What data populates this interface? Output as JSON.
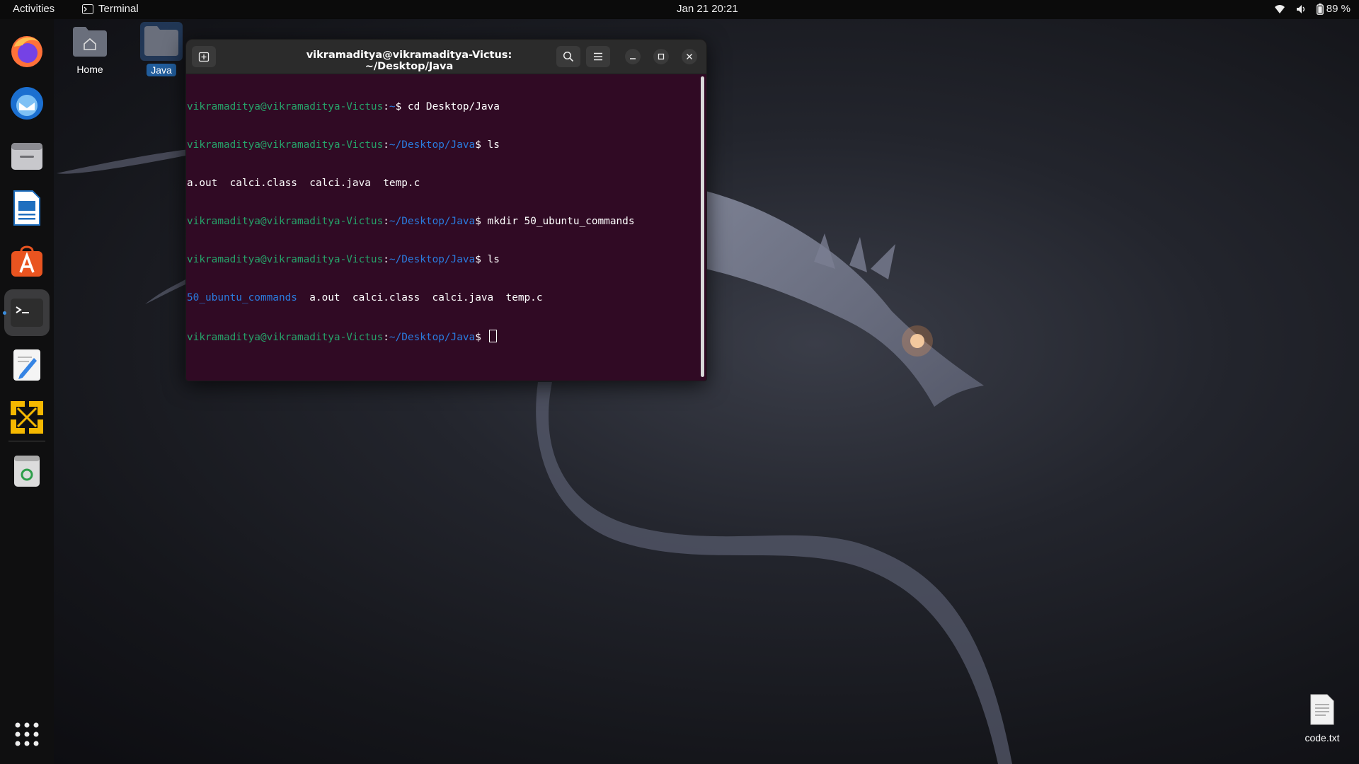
{
  "topbar": {
    "activities": "Activities",
    "app_name": "Terminal",
    "clock": "Jan 21  20:21",
    "battery": "89 %"
  },
  "dock": {
    "items": [
      {
        "name": "firefox",
        "icon": "firefox-icon"
      },
      {
        "name": "thunderbird",
        "icon": "thunderbird-icon"
      },
      {
        "name": "files",
        "icon": "files-icon"
      },
      {
        "name": "libreoffice-writer",
        "icon": "writer-icon"
      },
      {
        "name": "app-center",
        "icon": "app-center-icon"
      },
      {
        "name": "terminal",
        "icon": "terminal-icon",
        "active": true
      },
      {
        "name": "text-editor",
        "icon": "text-editor-icon"
      },
      {
        "name": "vmware",
        "icon": "vmware-icon"
      },
      {
        "name": "trash",
        "icon": "trash-icon"
      }
    ],
    "show_apps_icon": "grid-icon"
  },
  "desktop": {
    "home_label": "Home",
    "java_label": "Java",
    "code_file_label": "code.txt"
  },
  "terminal": {
    "title": "vikramaditya@vikramaditya-Victus: ~/Desktop/Java",
    "lines": [
      {
        "user": "vikramaditya@vikramaditya-Victus",
        "path": "~",
        "cmd": "$ cd Desktop/Java"
      },
      {
        "user": "vikramaditya@vikramaditya-Victus",
        "path": "~/Desktop/Java",
        "cmd": "$ ls"
      },
      {
        "output": "a.out  calci.class  calci.java  temp.c"
      },
      {
        "user": "vikramaditya@vikramaditya-Victus",
        "path": "~/Desktop/Java",
        "cmd": "$ mkdir 50_ubuntu_commands"
      },
      {
        "user": "vikramaditya@vikramaditya-Victus",
        "path": "~/Desktop/Java",
        "cmd": "$ ls"
      },
      {
        "dir": "50_ubuntu_commands",
        "output": "  a.out  calci.class  calci.java  temp.c"
      },
      {
        "user": "vikramaditya@vikramaditya-Victus",
        "path": "~/Desktop/Java",
        "cmd": "$ ",
        "cursor": true
      }
    ]
  },
  "colors": {
    "terminal_bg": "#300a24",
    "prompt_user": "#26a269",
    "prompt_path": "#2a7bde",
    "accent": "#3a8dde"
  }
}
